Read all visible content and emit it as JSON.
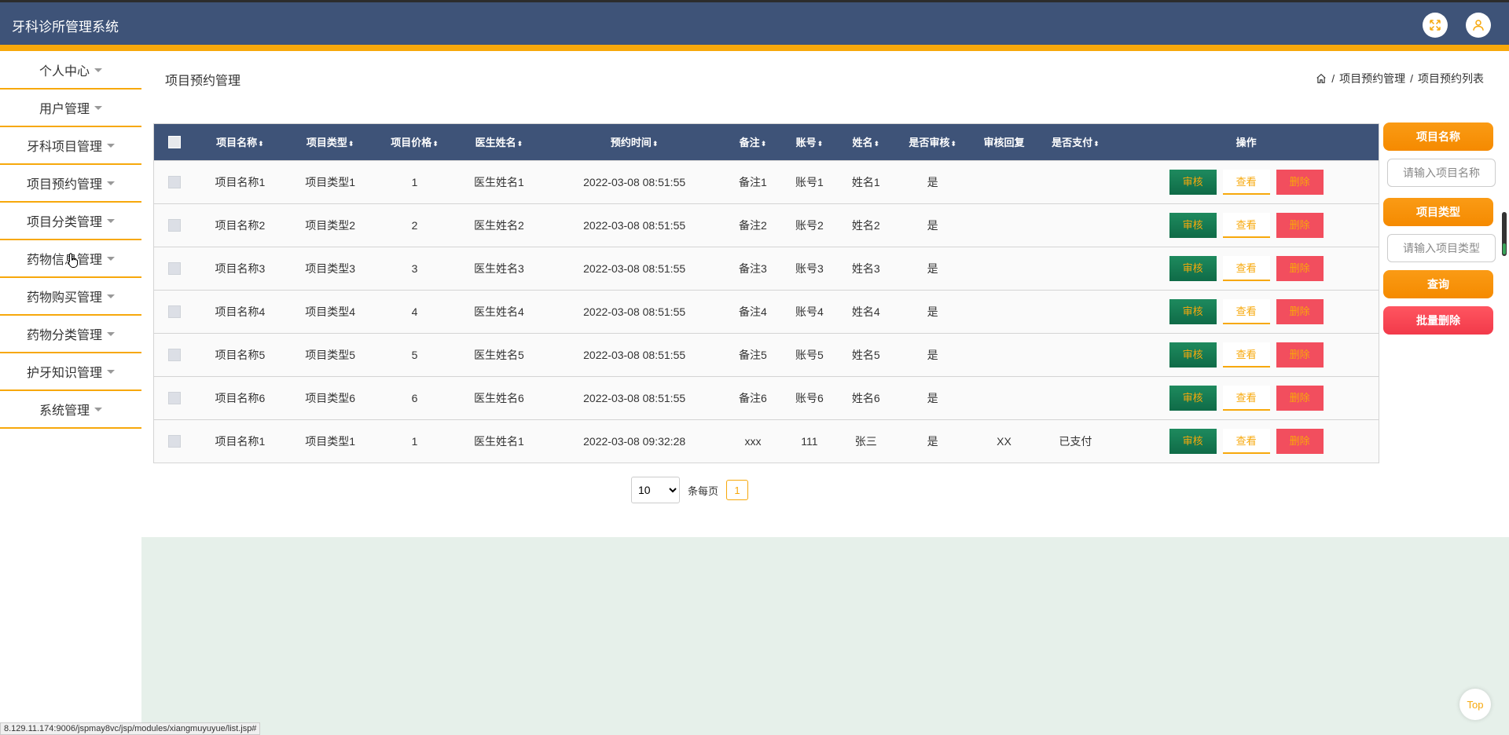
{
  "app": {
    "title": "牙科诊所管理系统"
  },
  "header": {
    "fullscreen_icon": "fullscreen-icon",
    "user_icon": "user-icon"
  },
  "sidebar": {
    "items": [
      {
        "label": "个人中心"
      },
      {
        "label": "用户管理"
      },
      {
        "label": "牙科项目管理"
      },
      {
        "label": "项目预约管理"
      },
      {
        "label": "项目分类管理"
      },
      {
        "label": "药物信息管理"
      },
      {
        "label": "药物购买管理"
      },
      {
        "label": "药物分类管理"
      },
      {
        "label": "护牙知识管理"
      },
      {
        "label": "系统管理"
      }
    ]
  },
  "page": {
    "title": "项目预约管理",
    "breadcrumb": [
      "项目预约管理",
      "项目预约列表"
    ],
    "breadcrumb_sep": "/"
  },
  "table": {
    "columns": [
      "项目名称",
      "项目类型",
      "项目价格",
      "医生姓名",
      "预约时间",
      "备注",
      "账号",
      "姓名",
      "是否审核",
      "审核回复",
      "是否支付",
      "操作"
    ],
    "sortable": [
      true,
      true,
      true,
      true,
      true,
      true,
      true,
      true,
      true,
      false,
      true,
      false
    ],
    "sort_glyph": "⬍",
    "actions": {
      "audit": "审核",
      "view": "查看",
      "delete": "删除"
    },
    "rows": [
      [
        "项目名称1",
        "项目类型1",
        "1",
        "医生姓名1",
        "2022-03-08 08:51:55",
        "备注1",
        "账号1",
        "姓名1",
        "是",
        "",
        ""
      ],
      [
        "项目名称2",
        "项目类型2",
        "2",
        "医生姓名2",
        "2022-03-08 08:51:55",
        "备注2",
        "账号2",
        "姓名2",
        "是",
        "",
        ""
      ],
      [
        "项目名称3",
        "项目类型3",
        "3",
        "医生姓名3",
        "2022-03-08 08:51:55",
        "备注3",
        "账号3",
        "姓名3",
        "是",
        "",
        ""
      ],
      [
        "项目名称4",
        "项目类型4",
        "4",
        "医生姓名4",
        "2022-03-08 08:51:55",
        "备注4",
        "账号4",
        "姓名4",
        "是",
        "",
        ""
      ],
      [
        "项目名称5",
        "项目类型5",
        "5",
        "医生姓名5",
        "2022-03-08 08:51:55",
        "备注5",
        "账号5",
        "姓名5",
        "是",
        "",
        ""
      ],
      [
        "项目名称6",
        "项目类型6",
        "6",
        "医生姓名6",
        "2022-03-08 08:51:55",
        "备注6",
        "账号6",
        "姓名6",
        "是",
        "",
        ""
      ],
      [
        "项目名称1",
        "项目类型1",
        "1",
        "医生姓名1",
        "2022-03-08 09:32:28",
        "xxx",
        "111",
        "张三",
        "是",
        "XX",
        "已支付"
      ]
    ]
  },
  "pager": {
    "page_size": "10",
    "page_size_options": [
      "10"
    ],
    "per_page_label": "条每页",
    "current_page": "1"
  },
  "search": {
    "name_label": "项目名称",
    "name_placeholder": "请输入项目名称",
    "type_label": "项目类型",
    "type_placeholder": "请输入项目类型",
    "query_button": "查询",
    "batch_delete_button": "批量删除"
  },
  "back_to_top": "Top",
  "status_url": "8.129.11.174:9006/jspmay8vc/jsp/modules/xiangmuyuyue/list.jsp#",
  "colors": {
    "header": "#3e5378",
    "accent": "#f7a80b",
    "audit": "#1e8a5e",
    "danger": "#f24e5e",
    "footer_bg": "#e6f0ea"
  }
}
